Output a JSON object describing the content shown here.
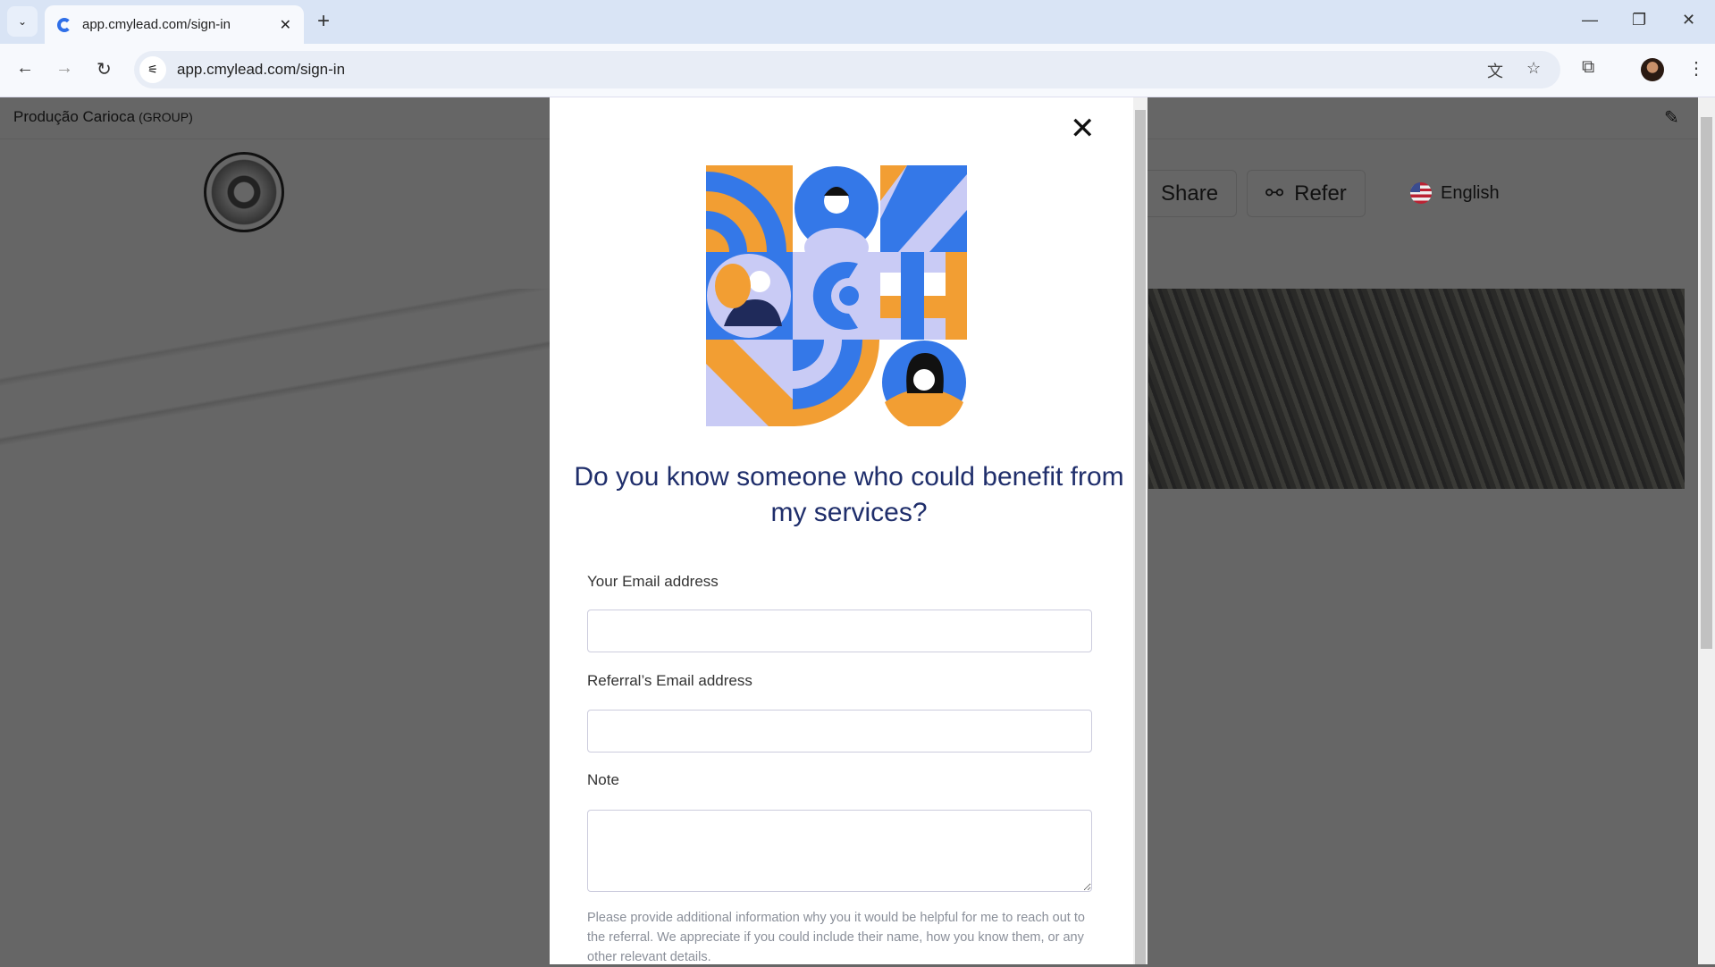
{
  "browser": {
    "tab_title": "app.cmylead.com/sign-in",
    "url": "app.cmylead.com/sign-in"
  },
  "page": {
    "org_name": "Produção Carioca",
    "org_type": "(GROUP)",
    "share_label": "Share",
    "refer_label": "Refer",
    "language": "English"
  },
  "modal": {
    "heading": "Do you know someone who could benefit from my services?",
    "email_label": "Your Email address",
    "email_value": "",
    "referral_label": "Referral’s Email address",
    "referral_value": "",
    "note_label": "Note",
    "note_value": "",
    "help_text": "Please provide additional information why you it would be helpful for me to reach out to the referral. We appreciate if you could include their name, how you know them, or any other relevant details."
  },
  "colors": {
    "blue": "#3478e8",
    "orange": "#f29e33",
    "lavender": "#c9cbf5",
    "heading": "#1f2e6b"
  }
}
